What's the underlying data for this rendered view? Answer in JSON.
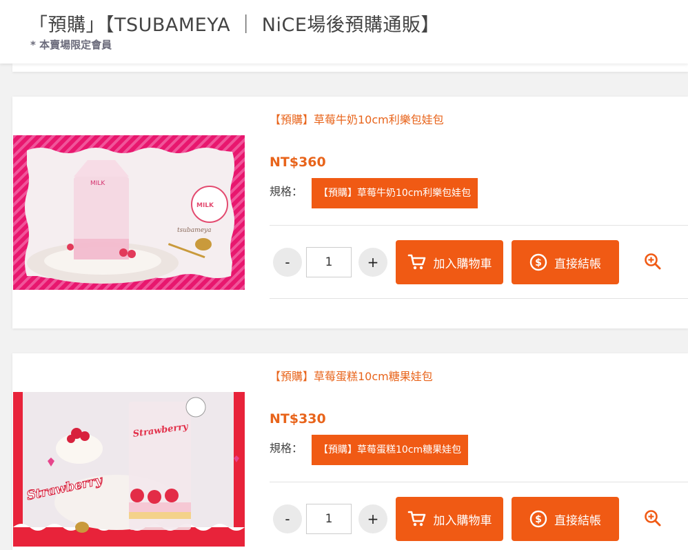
{
  "header": {
    "title": "「預購」【TSUBAMEYA ｜ NiCE場後預購通販】",
    "subtitle": "* 本賣場限定會員"
  },
  "colors": {
    "accent": "#f05a14",
    "accent_text": "#e8641b"
  },
  "common": {
    "spec_label": "規格：",
    "qty_minus": "-",
    "qty_plus": "+",
    "add_to_cart": "加入購物車",
    "checkout": "直接結帳",
    "icons": {
      "cart": "cart-icon",
      "dollar": "dollar-coin-icon",
      "zoom": "zoom-in-icon"
    }
  },
  "products": [
    {
      "name": "【預購】草莓牛奶10cm利樂包娃包",
      "price": "NT$360",
      "spec_option": "【預購】草莓牛奶10cm利樂包娃包",
      "qty": "1"
    },
    {
      "name": "【預購】草莓蛋糕10cm糖果娃包",
      "price": "NT$330",
      "spec_option": "【預購】草莓蛋糕10cm糖果娃包",
      "qty": "1"
    }
  ]
}
